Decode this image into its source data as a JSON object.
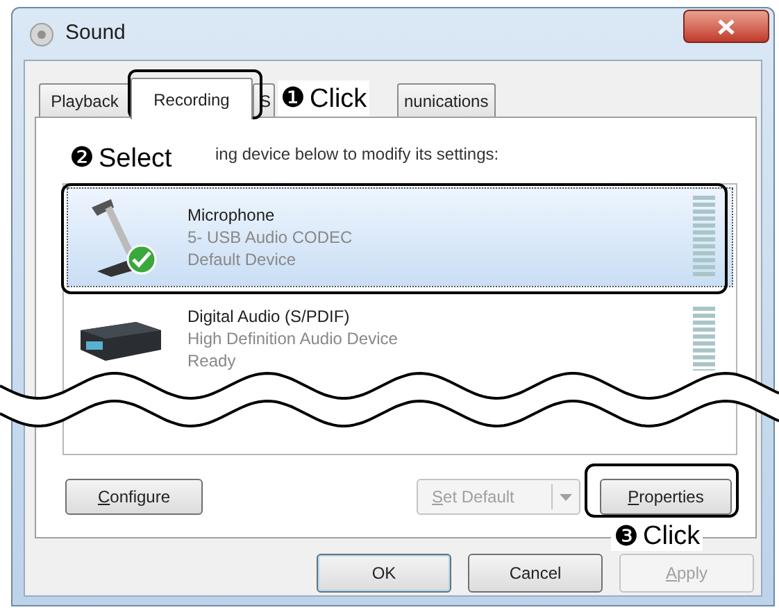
{
  "window": {
    "title": "Sound"
  },
  "tabs": [
    {
      "label": "Playback",
      "selected": false
    },
    {
      "label": "Recording",
      "selected": true
    },
    {
      "label": "S",
      "selected": false
    },
    {
      "label": "nunications",
      "selected": false
    }
  ],
  "instruction": "ing device below to modify its settings:",
  "devices": [
    {
      "kind": "microphone",
      "name": "Microphone",
      "driver": "5- USB Audio CODEC",
      "status": "Default Device",
      "selected": true,
      "default": true
    },
    {
      "kind": "digital-audio",
      "name": "Digital Audio (S/PDIF)",
      "driver": "High Definition Audio Device",
      "status": "Ready",
      "selected": false,
      "default": false
    }
  ],
  "panel_buttons": [
    {
      "label": "Configure",
      "disabled": false,
      "dropdown": false
    },
    {
      "label": "Set Default",
      "disabled": true,
      "dropdown": true
    },
    {
      "label": "Properties",
      "disabled": false,
      "dropdown": false
    }
  ],
  "dialog_buttons": [
    {
      "label": "OK",
      "disabled": false,
      "default": true,
      "underline_first": false
    },
    {
      "label": "Cancel",
      "disabled": false,
      "default": false,
      "underline_first": false
    },
    {
      "label": "Apply",
      "disabled": true,
      "default": false,
      "underline_first": true
    }
  ],
  "callouts": [
    {
      "number": "❶",
      "text": "Click"
    },
    {
      "number": "❷",
      "text": "Select"
    },
    {
      "number": "❸",
      "text": "Click"
    }
  ]
}
